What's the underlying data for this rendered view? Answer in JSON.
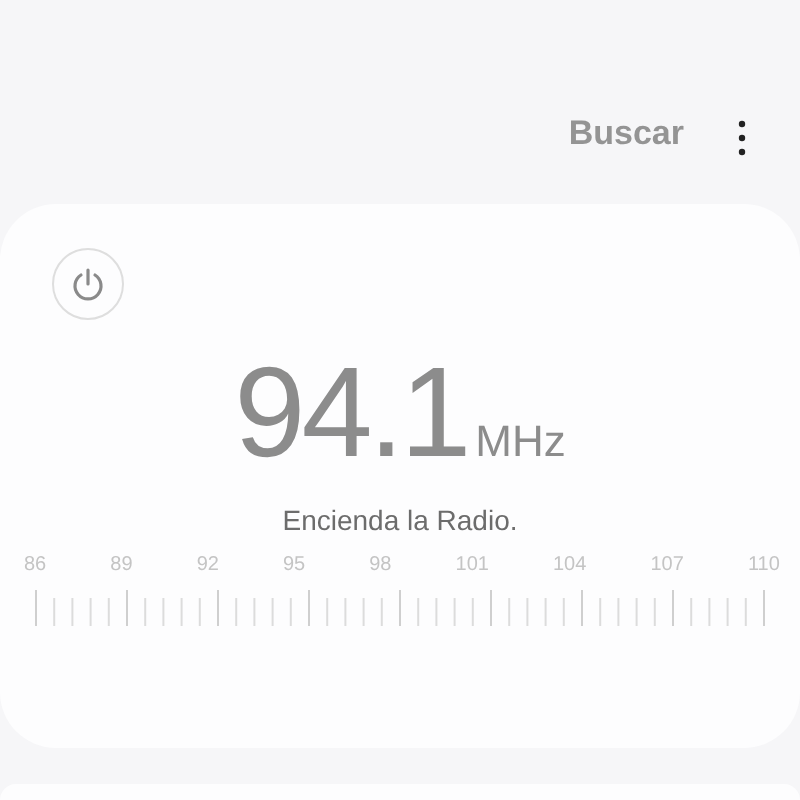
{
  "header": {
    "search_label": "Buscar"
  },
  "radio": {
    "on": false,
    "frequency": "94.1",
    "unit": "MHz",
    "message": "Encienda la Radio.",
    "scale_labels": [
      "86",
      "89",
      "92",
      "95",
      "98",
      "101",
      "104",
      "107",
      "110"
    ]
  }
}
